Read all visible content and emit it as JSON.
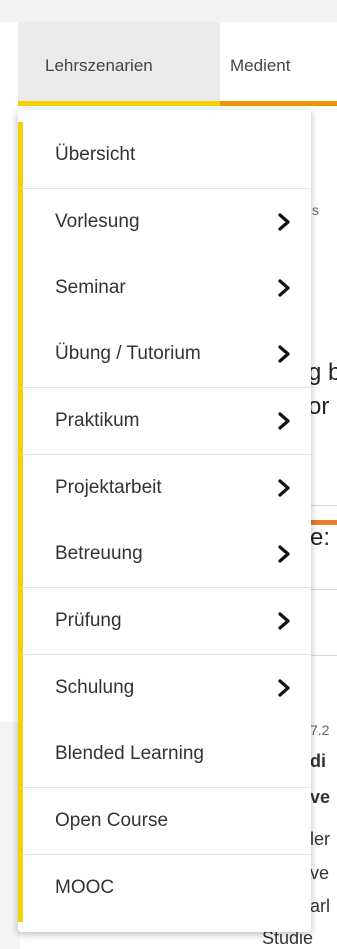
{
  "tabs": [
    {
      "label": "Lehrszenarien",
      "active": true
    },
    {
      "label": "Medient"
    }
  ],
  "menu": {
    "items": [
      {
        "label": "Übersicht",
        "has_submenu": false
      },
      {
        "label": "Vorlesung",
        "has_submenu": true
      },
      {
        "label": "Seminar",
        "has_submenu": true
      },
      {
        "label": "Übung / Tutorium",
        "has_submenu": true
      },
      {
        "label": "Praktikum",
        "has_submenu": true
      },
      {
        "label": "Projektarbeit",
        "has_submenu": true
      },
      {
        "label": "Betreuung",
        "has_submenu": true
      },
      {
        "label": "Prüfung",
        "has_submenu": true
      },
      {
        "label": "Schulung",
        "has_submenu": true
      },
      {
        "label": "Blended Learning",
        "has_submenu": false
      },
      {
        "label": "Open Course",
        "has_submenu": false
      },
      {
        "label": "MOOC",
        "has_submenu": false
      }
    ]
  },
  "background_fragments": {
    "s": "s",
    "g_b": "g b",
    "or": "or",
    "e_colon": "e:",
    "date_frag": "7.2",
    "di": "di",
    "ve_bold": "ve",
    "ler": "ler",
    "ve": "ve",
    "arl": "arl",
    "studie": "Studie"
  },
  "colors": {
    "accent_yellow": "#f2d300",
    "accent_orange": "#f29400",
    "orange_rule": "#ec7a2d"
  }
}
